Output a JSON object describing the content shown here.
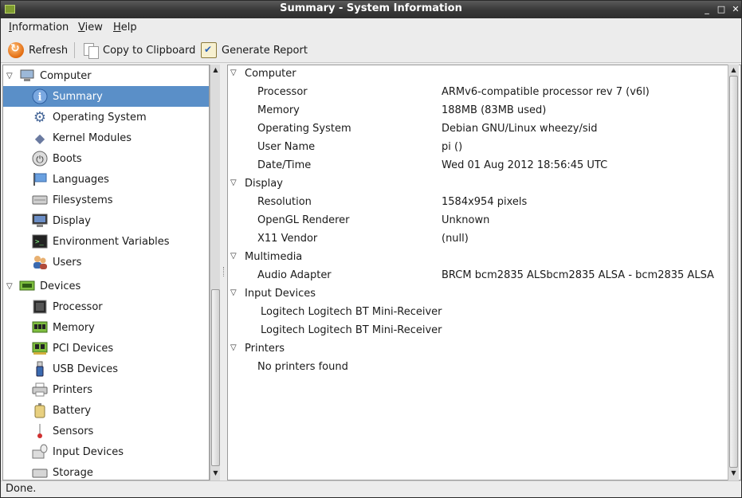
{
  "window": {
    "title": "Summary - System Information",
    "controls": {
      "minimize": "_",
      "maximize": "□",
      "close": "✕"
    }
  },
  "menubar": [
    "Information",
    "View",
    "Help"
  ],
  "toolbar": {
    "refresh": "Refresh",
    "copy": "Copy to Clipboard",
    "report": "Generate Report"
  },
  "tree": {
    "computer": {
      "label": "Computer",
      "items": [
        {
          "label": "Summary",
          "icon": "info-icon",
          "selected": true
        },
        {
          "label": "Operating System",
          "icon": "gear-icon"
        },
        {
          "label": "Kernel Modules",
          "icon": "kernel-icon"
        },
        {
          "label": "Boots",
          "icon": "power-icon"
        },
        {
          "label": "Languages",
          "icon": "flag-icon"
        },
        {
          "label": "Filesystems",
          "icon": "drive-icon"
        },
        {
          "label": "Display",
          "icon": "monitor-icon"
        },
        {
          "label": "Environment Variables",
          "icon": "terminal-icon"
        },
        {
          "label": "Users",
          "icon": "users-icon"
        }
      ]
    },
    "devices": {
      "label": "Devices",
      "items": [
        {
          "label": "Processor",
          "icon": "cpu-icon"
        },
        {
          "label": "Memory",
          "icon": "memory-icon"
        },
        {
          "label": "PCI Devices",
          "icon": "pci-icon"
        },
        {
          "label": "USB Devices",
          "icon": "usb-icon"
        },
        {
          "label": "Printers",
          "icon": "printer-icon"
        },
        {
          "label": "Battery",
          "icon": "battery-icon"
        },
        {
          "label": "Sensors",
          "icon": "thermometer-icon"
        },
        {
          "label": "Input Devices",
          "icon": "input-device-icon"
        },
        {
          "label": "Storage",
          "icon": "storage-icon"
        }
      ]
    }
  },
  "details": {
    "computer": {
      "label": "Computer",
      "rows": [
        {
          "key": "Processor",
          "value": "ARMv6-compatible processor rev 7 (v6l)"
        },
        {
          "key": "Memory",
          "value": "188MB (83MB used)"
        },
        {
          "key": "Operating System",
          "value": "Debian GNU/Linux wheezy/sid"
        },
        {
          "key": "User Name",
          "value": "pi ()"
        },
        {
          "key": "Date/Time",
          "value": "Wed 01 Aug 2012 18:56:45 UTC"
        }
      ]
    },
    "display": {
      "label": "Display",
      "rows": [
        {
          "key": "Resolution",
          "value": "1584x954 pixels"
        },
        {
          "key": "OpenGL Renderer",
          "value": "Unknown"
        },
        {
          "key": "X11 Vendor",
          "value": "(null)"
        }
      ]
    },
    "multimedia": {
      "label": "Multimedia",
      "rows": [
        {
          "key": "Audio Adapter",
          "value": "BRCM bcm2835 ALSbcm2835 ALSA - bcm2835 ALSA"
        }
      ]
    },
    "input_devices": {
      "label": "Input Devices",
      "rows": [
        {
          "key": "Logitech Logitech BT Mini-Receiver"
        },
        {
          "key": "Logitech Logitech BT Mini-Receiver"
        }
      ]
    },
    "printers": {
      "label": "Printers",
      "rows": [
        {
          "key": "No printers found"
        }
      ]
    }
  },
  "status": "Done."
}
